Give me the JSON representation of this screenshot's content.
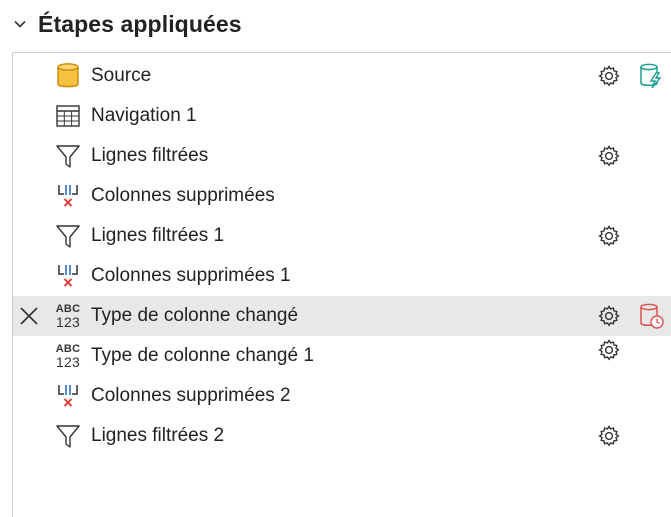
{
  "panel": {
    "title": "Étapes appliquées"
  },
  "steps": [
    {
      "label": "Source",
      "icon": "database-icon",
      "has_gear": true,
      "extra_icon": "database-lightning-icon"
    },
    {
      "label": "Navigation 1",
      "icon": "table-icon",
      "has_gear": false
    },
    {
      "label": "Lignes filtrées",
      "icon": "filter-icon",
      "has_gear": true
    },
    {
      "label": "Colonnes supprimées",
      "icon": "remove-columns-icon",
      "has_gear": false
    },
    {
      "label": "Lignes filtrées 1",
      "icon": "filter-icon",
      "has_gear": true
    },
    {
      "label": "Colonnes supprimées 1",
      "icon": "remove-columns-icon",
      "has_gear": false
    },
    {
      "label": "Type de colonne changé",
      "icon": "abc-123-type-icon",
      "has_gear": true,
      "selected": true,
      "extra_icon": "database-clock-icon"
    },
    {
      "label": "Type de colonne changé 1",
      "icon": "abc-123-type-icon",
      "has_gear": true
    },
    {
      "label": "Colonnes supprimées 2",
      "icon": "remove-columns-icon",
      "has_gear": false
    },
    {
      "label": "Lignes filtrées 2",
      "icon": "filter-icon",
      "has_gear": true
    }
  ],
  "type_icon_text": {
    "top": "ABC",
    "bottom": "123"
  },
  "colors": {
    "selected_row": "#e8e8e8",
    "database_fill": "#f5c242",
    "database_stroke": "#c98a00",
    "lightning_teal": "#1a9f8f",
    "clock_red": "#d9534f",
    "remove_blue": "#2f6fc0",
    "remove_red": "#e03030"
  }
}
